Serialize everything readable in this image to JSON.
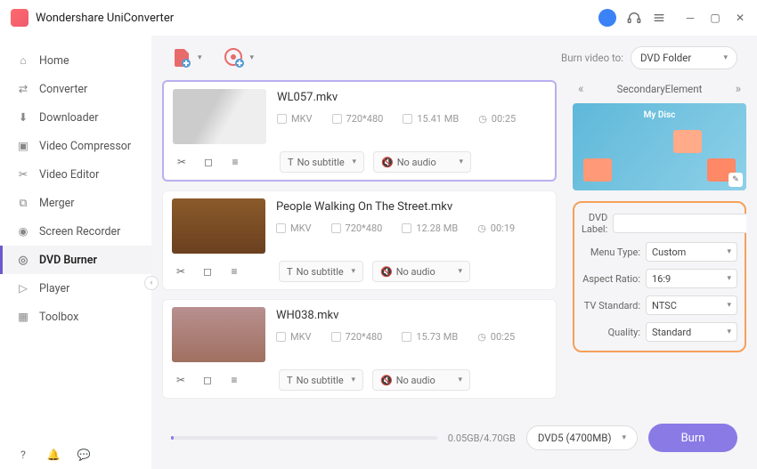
{
  "app": {
    "title": "Wondershare UniConverter"
  },
  "sidebar": {
    "items": [
      {
        "label": "Home",
        "icon": "home-icon"
      },
      {
        "label": "Converter",
        "icon": "converter-icon"
      },
      {
        "label": "Downloader",
        "icon": "downloader-icon"
      },
      {
        "label": "Video Compressor",
        "icon": "compressor-icon"
      },
      {
        "label": "Video Editor",
        "icon": "editor-icon"
      },
      {
        "label": "Merger",
        "icon": "merger-icon"
      },
      {
        "label": "Screen Recorder",
        "icon": "recorder-icon"
      },
      {
        "label": "DVD Burner",
        "icon": "dvd-burner-icon"
      },
      {
        "label": "Player",
        "icon": "player-icon"
      },
      {
        "label": "Toolbox",
        "icon": "toolbox-icon"
      }
    ]
  },
  "toolbar": {
    "burn_to_label": "Burn video to:",
    "burn_to_value": "DVD Folder"
  },
  "files": [
    {
      "title": "WL057.mkv",
      "format": "MKV",
      "resolution": "720*480",
      "size": "15.41 MB",
      "duration": "00:25",
      "subtitle": "No subtitle",
      "audio": "No audio"
    },
    {
      "title": "People Walking On The Street.mkv",
      "format": "MKV",
      "resolution": "720*480",
      "size": "12.28 MB",
      "duration": "00:19",
      "subtitle": "No subtitle",
      "audio": "No audio"
    },
    {
      "title": "WH038.mkv",
      "format": "MKV",
      "resolution": "720*480",
      "size": "15.73 MB",
      "duration": "00:25",
      "subtitle": "No subtitle",
      "audio": "No audio"
    }
  ],
  "template": {
    "name": "SecondaryElement"
  },
  "settings": {
    "dvd_label_label": "DVD Label:",
    "dvd_label_value": "",
    "menu_type_label": "Menu Type:",
    "menu_type_value": "Custom",
    "aspect_label": "Aspect Ratio:",
    "aspect_value": "16:9",
    "tv_label": "TV Standard:",
    "tv_value": "NTSC",
    "quality_label": "Quality:",
    "quality_value": "Standard"
  },
  "footer": {
    "size": "0.05GB/4.70GB",
    "disc": "DVD5 (4700MB)",
    "burn_label": "Burn"
  }
}
